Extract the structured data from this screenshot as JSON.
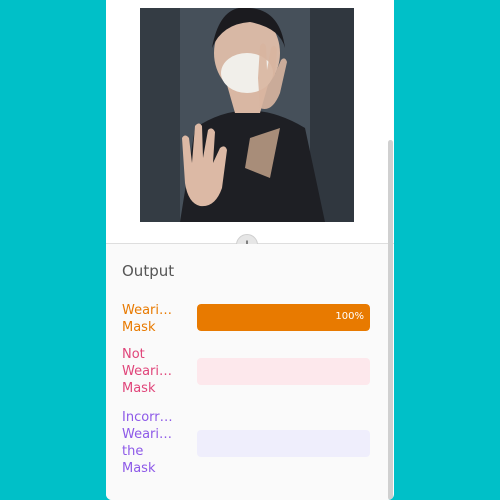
{
  "output": {
    "title": "Output",
    "results": [
      {
        "label": "Weari…\nMask",
        "value_text": "100%",
        "value": 1.0,
        "color": "#e87a00",
        "track_color": "#fde3cc"
      },
      {
        "label": "Not\nWeari…\nMask",
        "value_text": "",
        "value": 0.0,
        "color": "#e0457a",
        "track_color": "#fde8ec"
      },
      {
        "label": "Incorr…\nWeari…\nthe\nMask",
        "value_text": "",
        "value": 0.0,
        "color": "#8d59e8",
        "track_color": "#efeefc"
      }
    ]
  },
  "icons": {
    "scroll_button": "arrow-down-icon"
  }
}
